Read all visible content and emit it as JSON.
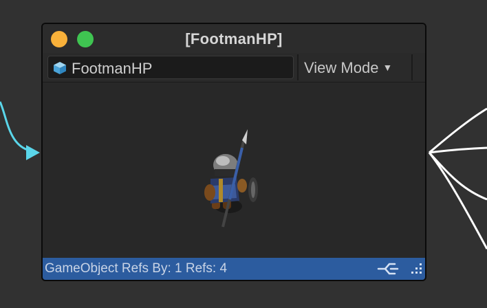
{
  "node": {
    "title": "[FootmanHP]",
    "object_field": {
      "value": "FootmanHP",
      "icon": "cube-icon"
    },
    "view_mode": {
      "label": "View Mode",
      "icon": "chevron-down-icon"
    },
    "status": {
      "text": "GameObject Refs By: 1 Refs: 4"
    },
    "preview": {
      "content": "footman-model"
    }
  },
  "colors": {
    "canvas": "#313131",
    "status_bar": "#2c5c9f",
    "input_wire": "#5ad6ea",
    "output_wires": "#ffffff",
    "close_dot": "#f9b13a",
    "maximize_dot": "#3fc451"
  }
}
